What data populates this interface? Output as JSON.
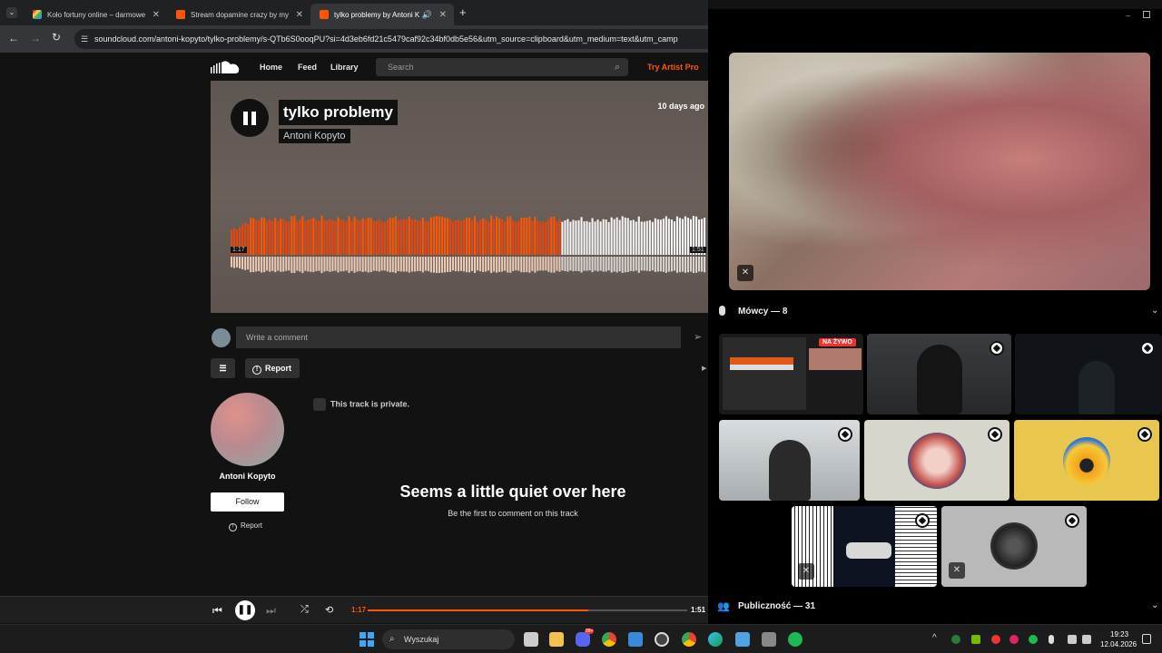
{
  "browser": {
    "tabs": [
      {
        "label": "Koło fortuny online – darmowe",
        "favicon_color": "#4a8fe7"
      },
      {
        "label": "Stream dopamine crazy by my",
        "favicon_color": "#ff5500"
      },
      {
        "label": "tylko problemy by Antoni K",
        "favicon_color": "#ff5500"
      }
    ],
    "url": "soundcloud.com/antoni-kopyto/tylko-problemy/s-QTb6S0ooqPU?si=4d3eb6fd21c5479caf92c34bf0db5e56&utm_source=clipboard&utm_medium=text&utm_camp"
  },
  "soundcloud": {
    "nav": {
      "home": "Home",
      "feed": "Feed",
      "library": "Library",
      "search_placeholder": "Search",
      "try_pro": "Try Artist Pro"
    },
    "track": {
      "title": "tylko problemy",
      "artist": "Antoni Kopyto",
      "posted": "10 days ago",
      "elapsed": "1:17",
      "duration": "1:51",
      "progress": 0.69
    },
    "comment_placeholder": "Write a comment",
    "report_label": "Report",
    "private_notice": "This track is private.",
    "profile": {
      "name": "Antoni Kopyto",
      "follow": "Follow",
      "report": "Report"
    },
    "empty": {
      "title": "Seems a little quiet over here",
      "subtitle": "Be the first to comment on this track"
    },
    "player": {
      "elapsed": "1:17",
      "duration": "1:51",
      "progress": 0.69
    }
  },
  "discord": {
    "speakers_header": "Mówcy — 8",
    "audience_header": "Publiczność — 31",
    "live_badge": "NA ŻYWO"
  },
  "taskbar": {
    "search_placeholder": "Wyszukaj",
    "time": "19:23",
    "date": "12.04.2026",
    "notification_count": "99+"
  },
  "colors": {
    "accent": "#ff5500",
    "bg": "#121212"
  }
}
